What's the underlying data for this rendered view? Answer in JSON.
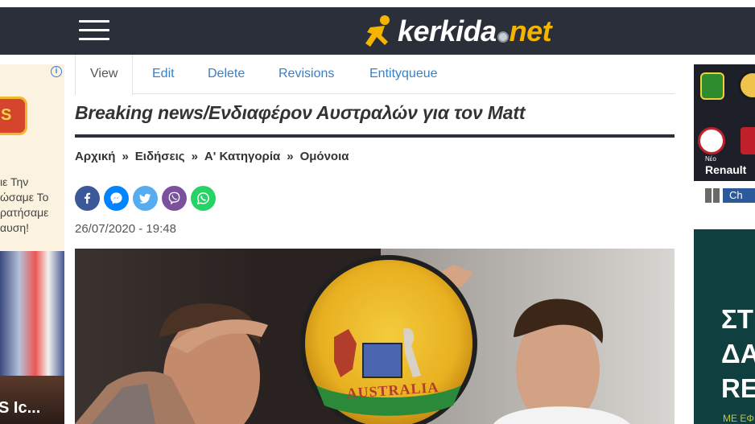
{
  "site": {
    "logo_part1": "kerkida",
    "logo_part2": "net"
  },
  "tabs": [
    {
      "label": "View"
    },
    {
      "label": "Edit"
    },
    {
      "label": "Delete"
    },
    {
      "label": "Revisions"
    },
    {
      "label": "Entityqueue"
    }
  ],
  "article": {
    "title": "Breaking news/Ενδιαφέρον Αυστραλών για τον Matt",
    "date": "26/07/2020 - 19:48",
    "hero_badge_text": "AUSTRALIA"
  },
  "breadcrumb": {
    "items": [
      "Αρχική",
      "Ειδήσεις",
      "Α' Κατηγορία",
      "Ομόνοια"
    ],
    "separator": "»"
  },
  "share": [
    {
      "name": "facebook-icon",
      "color": "#3b5998"
    },
    {
      "name": "messenger-icon",
      "color": "#0084ff"
    },
    {
      "name": "twitter-icon",
      "color": "#55acee"
    },
    {
      "name": "viber-icon",
      "color": "#7b519d"
    },
    {
      "name": "whatsapp-icon",
      "color": "#25d366"
    }
  ],
  "left_ad": {
    "info_symbol": "i",
    "logo_text": "S",
    "text_lines": [
      "ιε Την",
      "ώσαμε Το",
      "ρατήσαμε",
      "αυση!"
    ],
    "caption": "S Ic..."
  },
  "right_ad_top": {
    "brand_small": "Νέο",
    "brand": "Renault",
    "button_text": "Ch"
  },
  "right_ad_bottom": {
    "lines": [
      "ΣΤ",
      "ΔΑ",
      "RE"
    ],
    "footer": "ΜΕ ΕΦ"
  },
  "colors": {
    "navbar": "#2b2f3a",
    "accent": "#f5b400",
    "link": "#3b7fc4"
  }
}
